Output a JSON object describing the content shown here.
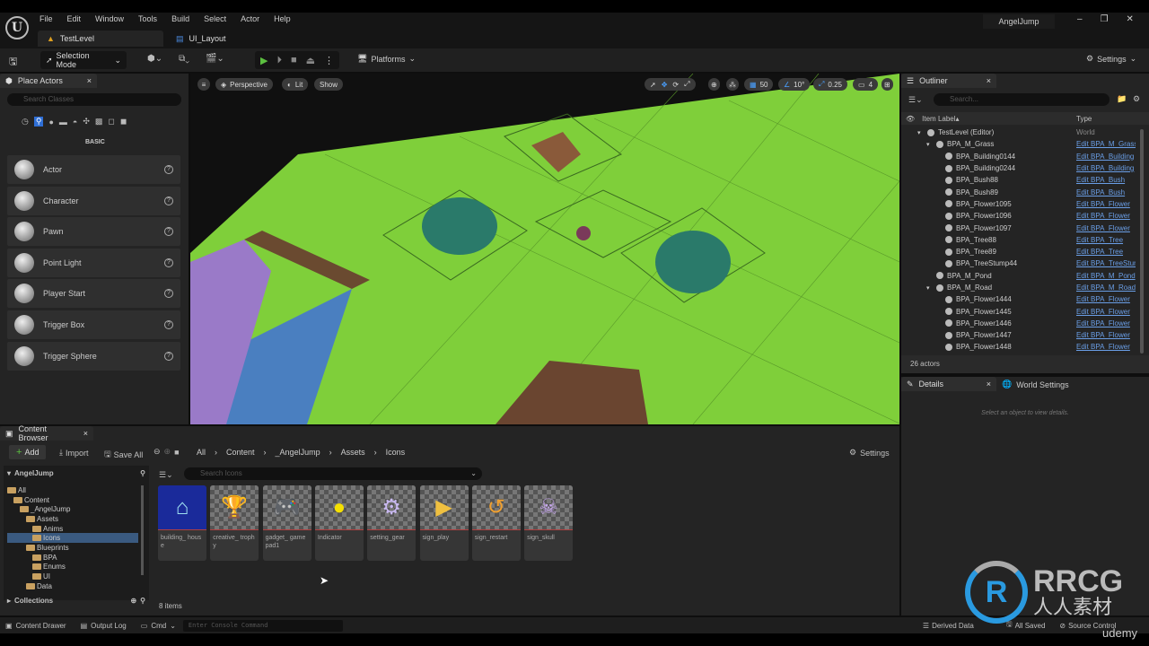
{
  "menu": [
    "File",
    "Edit",
    "Window",
    "Tools",
    "Build",
    "Select",
    "Actor",
    "Help"
  ],
  "tabs": [
    "TestLevel",
    "UI_Layout"
  ],
  "project_name": "AngelJump",
  "toolbar": {
    "selection_mode": "Selection Mode",
    "platforms": "Platforms",
    "settings": "Settings"
  },
  "place_actors": {
    "title": "Place Actors",
    "search_placeholder": "Search Classes",
    "category": "BASIC",
    "items": [
      "Actor",
      "Character",
      "Pawn",
      "Point Light",
      "Player Start",
      "Trigger Box",
      "Trigger Sphere"
    ]
  },
  "viewport": {
    "perspective": "Perspective",
    "lit": "Lit",
    "show": "Show",
    "grid_snap": "50",
    "rotation_snap": "10°",
    "scale_snap": "0.25",
    "camera_speed": "4",
    "colors": {
      "grass": "#7fcf3a",
      "water": "#4a7fc0",
      "purple": "#9a7ac8"
    }
  },
  "outliner": {
    "title": "Outliner",
    "search_placeholder": "Search...",
    "col_label": "Item Label",
    "col_type": "Type",
    "rows": [
      {
        "label": "TestLevel (Editor)",
        "type": "World",
        "depth": 0,
        "expand": true,
        "link": false
      },
      {
        "label": "BPA_M_Grass",
        "type": "Edit BPA_M_Grass",
        "depth": 1,
        "expand": true,
        "link": true
      },
      {
        "label": "BPA_Building0144",
        "type": "Edit BPA_Building",
        "depth": 2,
        "link": true
      },
      {
        "label": "BPA_Building0244",
        "type": "Edit BPA_Building",
        "depth": 2,
        "link": true
      },
      {
        "label": "BPA_Bush88",
        "type": "Edit BPA_Bush",
        "depth": 2,
        "link": true
      },
      {
        "label": "BPA_Bush89",
        "type": "Edit BPA_Bush",
        "depth": 2,
        "link": true
      },
      {
        "label": "BPA_Flower1095",
        "type": "Edit BPA_Flower",
        "depth": 2,
        "link": true
      },
      {
        "label": "BPA_Flower1096",
        "type": "Edit BPA_Flower",
        "depth": 2,
        "link": true
      },
      {
        "label": "BPA_Flower1097",
        "type": "Edit BPA_Flower",
        "depth": 2,
        "link": true
      },
      {
        "label": "BPA_Tree88",
        "type": "Edit BPA_Tree",
        "depth": 2,
        "link": true
      },
      {
        "label": "BPA_Tree89",
        "type": "Edit BPA_Tree",
        "depth": 2,
        "link": true
      },
      {
        "label": "BPA_TreeStump44",
        "type": "Edit BPA_TreeStump",
        "depth": 2,
        "link": true
      },
      {
        "label": "BPA_M_Pond",
        "type": "Edit BPA_M_Pond",
        "depth": 1,
        "link": true
      },
      {
        "label": "BPA_M_Road",
        "type": "Edit BPA_M_Road",
        "depth": 1,
        "expand": true,
        "link": true
      },
      {
        "label": "BPA_Flower1444",
        "type": "Edit BPA_Flower",
        "depth": 2,
        "link": true
      },
      {
        "label": "BPA_Flower1445",
        "type": "Edit BPA_Flower",
        "depth": 2,
        "link": true
      },
      {
        "label": "BPA_Flower1446",
        "type": "Edit BPA_Flower",
        "depth": 2,
        "link": true
      },
      {
        "label": "BPA_Flower1447",
        "type": "Edit BPA_Flower",
        "depth": 2,
        "link": true
      },
      {
        "label": "BPA_Flower1448",
        "type": "Edit BPA_Flower",
        "depth": 2,
        "link": true
      }
    ],
    "count": "26 actors"
  },
  "details": {
    "tab": "Details",
    "world_settings": "World Settings",
    "empty": "Select an object to view details."
  },
  "content_browser": {
    "title": "Content Browser",
    "add": "Add",
    "import": "Import",
    "save_all": "Save All",
    "settings": "Settings",
    "breadcrumb": [
      "All",
      "Content",
      "_AngelJump",
      "Assets",
      "Icons"
    ],
    "root": "AngelJump",
    "search_placeholder": "Search Icons",
    "tree": [
      {
        "label": "All",
        "depth": 0
      },
      {
        "label": "Content",
        "depth": 1
      },
      {
        "label": "_AngelJump",
        "depth": 2
      },
      {
        "label": "Assets",
        "depth": 3
      },
      {
        "label": "Anims",
        "depth": 4
      },
      {
        "label": "Icons",
        "depth": 4,
        "selected": true
      },
      {
        "label": "Blueprints",
        "depth": 3
      },
      {
        "label": "BPA",
        "depth": 4
      },
      {
        "label": "Enums",
        "depth": 4
      },
      {
        "label": "UI",
        "depth": 4
      },
      {
        "label": "Data",
        "depth": 3
      }
    ],
    "collections": "Collections",
    "assets": [
      {
        "name": "building_ house",
        "glyph": "⌂",
        "color": "#9fe0f0",
        "bg": "#1a2a9a"
      },
      {
        "name": "creative_ trophy",
        "glyph": "🏆",
        "color": "#f0a030"
      },
      {
        "name": "gadget_ gamepad1",
        "glyph": "🎮",
        "color": "#d8d0f0"
      },
      {
        "name": "Indicator",
        "glyph": "●",
        "color": "#f5e000"
      },
      {
        "name": "setting_gear",
        "glyph": "⚙",
        "color": "#c8b8f0"
      },
      {
        "name": "sign_play",
        "glyph": "▶",
        "color": "#f0c040"
      },
      {
        "name": "sign_restart",
        "glyph": "↺",
        "color": "#f0a030"
      },
      {
        "name": "sign_skull",
        "glyph": "☠",
        "color": "#c8a8f0"
      }
    ],
    "item_count": "8 items"
  },
  "status": {
    "content_drawer": "Content Drawer",
    "output_log": "Output Log",
    "cmd": "Cmd",
    "console_placeholder": "Enter Console Command",
    "derived_data": "Derived Data",
    "all_saved": "All Saved",
    "source_control": "Source Control"
  },
  "watermark": {
    "brand": "RRCG",
    "sub": "人人素材",
    "udemy": "udemy"
  }
}
